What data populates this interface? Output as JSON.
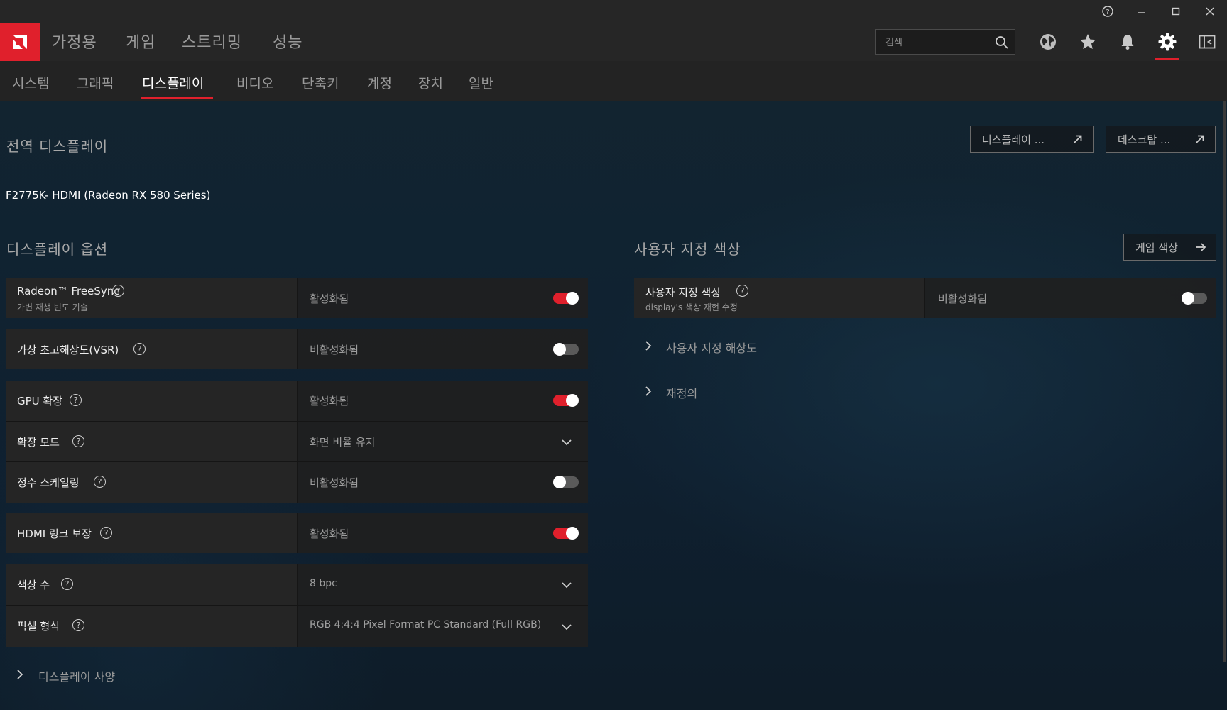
{
  "window": {
    "controls": {
      "help_icon": "help-icon",
      "minimize_icon": "minimize-icon",
      "maximize_icon": "maximize-icon",
      "close_icon": "close-icon"
    }
  },
  "brand": {
    "logo_icon": "amd-logo-icon",
    "accent_color": "#e0202c"
  },
  "main_tabs": [
    "가정용",
    "게임",
    "스트리밍",
    "성능"
  ],
  "search": {
    "placeholder": "검색"
  },
  "top_icons": [
    "globe-icon",
    "star-icon",
    "bell-icon",
    "gear-icon",
    "sidebar-icon"
  ],
  "sub_tabs": {
    "items": [
      "시스템",
      "그래픽",
      "디스플레이",
      "비디오",
      "단축키",
      "계정",
      "장치",
      "일반"
    ],
    "active": "디스플레이"
  },
  "page": {
    "title": "전역 디스플레이",
    "buttons": {
      "display": "디스플레이 ...",
      "desktop": "데스크탑 ..."
    },
    "display_name": "F2775K- HDMI (Radeon RX 580 Series)"
  },
  "display_options": {
    "title": "디스플레이 옵션",
    "freesync": {
      "label": "Radeon™ FreeSync",
      "sub": "가변 재생 빈도 기술",
      "value": "활성화됨",
      "on": true
    },
    "vsr": {
      "label": "가상 초고해상도(VSR)",
      "value": "비활성화됨",
      "on": false
    },
    "gpu_scaling": {
      "label": "GPU 확장",
      "value": "활성화됨",
      "on": true
    },
    "scaling_mode": {
      "label": "확장 모드",
      "value": "화면 비율 유지"
    },
    "integer_scaling": {
      "label": "정수 스케일링",
      "value": "비활성화됨",
      "on": false
    },
    "hdmi_link": {
      "label": "HDMI 링크 보장",
      "value": "활성화됨",
      "on": true
    },
    "color_depth": {
      "label": "색상 수",
      "value": "8 bpc"
    },
    "pixel_format": {
      "label": "픽셀 형식",
      "value": "RGB 4:4:4 Pixel Format PC Standard (Full RGB)"
    },
    "display_specs": "디스플레이 사양"
  },
  "custom_color": {
    "title": "사용자 지정 색상",
    "game_color_button": "게임 색상",
    "row": {
      "label": "사용자 지정 색상",
      "sub": "display's 색상 재현 수정",
      "value": "비활성화됨",
      "on": false
    },
    "custom_resolution": "사용자 지정 해상도",
    "override": "재정의"
  }
}
